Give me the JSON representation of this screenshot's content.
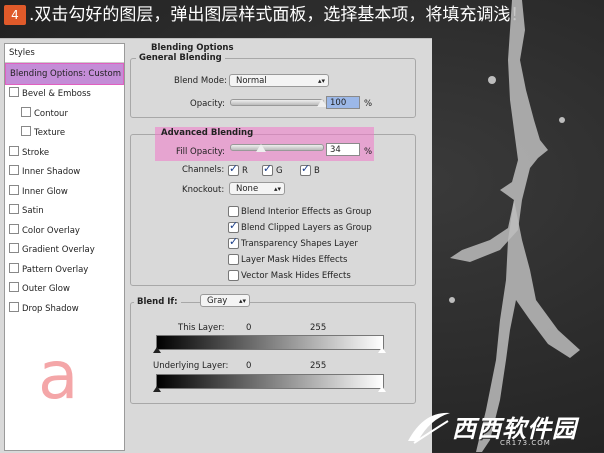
{
  "caption": {
    "badge": "4",
    "text": ".双击勾好的图层，弹出图层样式面板，选择基本项，将填充调浅！"
  },
  "sidebar": {
    "header": "Styles",
    "selected": "Blending Options: Custom",
    "items": [
      "Bevel & Emboss",
      "Contour",
      "Texture",
      "Stroke",
      "Inner Shadow",
      "Inner Glow",
      "Satin",
      "Color Overlay",
      "Gradient Overlay",
      "Pattern Overlay",
      "Outer Glow",
      "Drop Shadow"
    ]
  },
  "annotation_letter": "a",
  "blending": {
    "title": "Blending Options",
    "general": {
      "title": "General Blending",
      "blend_mode_label": "Blend Mode:",
      "blend_mode_value": "Normal",
      "opacity_label": "Opacity:",
      "opacity_value": "100",
      "opacity_unit": "%",
      "opacity_fraction": 1.0
    },
    "advanced": {
      "title": "Advanced Blending",
      "fill_opacity_label": "Fill Opacity:",
      "fill_opacity_value": "34",
      "fill_opacity_unit": "%",
      "fill_opacity_fraction": 0.34,
      "channels_label": "Channels:",
      "channels": [
        {
          "label": "R",
          "checked": true
        },
        {
          "label": "G",
          "checked": true
        },
        {
          "label": "B",
          "checked": true
        }
      ],
      "knockout_label": "Knockout:",
      "knockout_value": "None",
      "options": [
        {
          "label": "Blend Interior Effects as Group",
          "checked": false
        },
        {
          "label": "Blend Clipped Layers as Group",
          "checked": true
        },
        {
          "label": "Transparency Shapes Layer",
          "checked": true
        },
        {
          "label": "Layer Mask Hides Effects",
          "checked": false
        },
        {
          "label": "Vector Mask Hides Effects",
          "checked": false
        }
      ]
    },
    "blend_if": {
      "label": "Blend If:",
      "value": "Gray",
      "this_layer_label": "This Layer:",
      "this_layer_min": "0",
      "this_layer_max": "255",
      "underlying_label": "Underlying Layer:",
      "underlying_min": "0",
      "underlying_max": "255"
    }
  },
  "watermark": {
    "text": "西西软件园",
    "url_text": "CR173.COM"
  },
  "colors": {
    "highlight_pink": "#f078c8",
    "selected_item": "#c48dd7",
    "annotation": "#f4a6a8"
  }
}
